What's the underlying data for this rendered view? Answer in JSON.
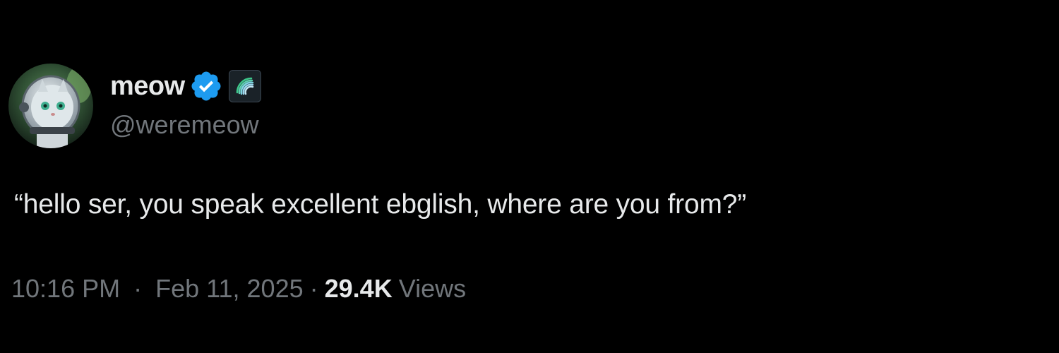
{
  "author": {
    "display_name": "meow",
    "handle": "@weremeow",
    "verified": true,
    "avatar_icon": "cat-astronaut-avatar",
    "badge_icon": "affiliate-badge-icon"
  },
  "tweet": {
    "text": "“hello ser, you speak excellent ebglish, where are you from?”"
  },
  "meta": {
    "time": "10:16 PM",
    "separator": "·",
    "date": "Feb 11, 2025",
    "views_count": "29.4K",
    "views_label": "Views"
  },
  "colors": {
    "background": "#000000",
    "primary_text": "#e7e9ea",
    "secondary_text": "#71767b",
    "verified_blue": "#1d9bf0"
  }
}
